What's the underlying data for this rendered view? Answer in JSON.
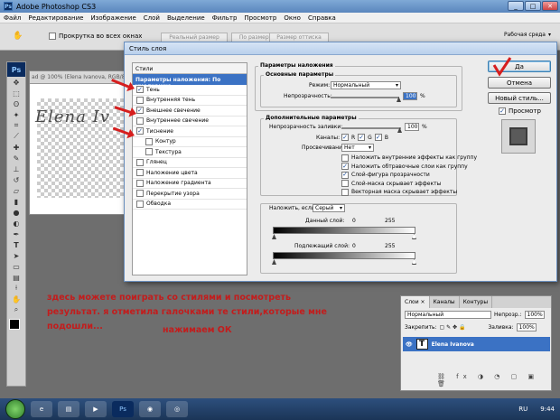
{
  "window": {
    "title": "Adobe Photoshop CS3",
    "app_icon": "Ps",
    "min_label": "_",
    "max_label": "□",
    "close_label": "✕"
  },
  "menu": [
    "Файл",
    "Редактирование",
    "Изображение",
    "Слой",
    "Выделение",
    "Фильтр",
    "Просмотр",
    "Окно",
    "Справка"
  ],
  "options": {
    "scroll_all": "Прокрутка во всех окнах",
    "actual_pixels": "Реальный размер",
    "fit_screen": "По размеру экрана",
    "print_size": "Размер оттиска",
    "workspace": "Рабочая среда"
  },
  "document": {
    "tab": "ad @ 100% (Elena Ivanova, RGB/8)",
    "signature": "Elena Iv"
  },
  "dialog": {
    "title": "Стиль слоя",
    "styles_header": "Стили",
    "blend_defaults": "Параметры наложения: По умолчанию",
    "styles": [
      {
        "label": "Тень",
        "checked": true
      },
      {
        "label": "Внутренняя тень",
        "checked": false
      },
      {
        "label": "Внешнее свечение",
        "checked": true
      },
      {
        "label": "Внутреннее свечение",
        "checked": false
      },
      {
        "label": "Тиснение",
        "checked": true
      },
      {
        "label": "Контур",
        "checked": false,
        "sub": true
      },
      {
        "label": "Текстура",
        "checked": false,
        "sub": true
      },
      {
        "label": "Глянец",
        "checked": false
      },
      {
        "label": "Наложение цвета",
        "checked": false
      },
      {
        "label": "Наложение градиента",
        "checked": false
      },
      {
        "label": "Перекрытие узора",
        "checked": false
      },
      {
        "label": "Обводка",
        "checked": false
      }
    ],
    "blend_options_title": "Параметры наложения",
    "basic_title": "Основные параметры",
    "mode_label": "Режим:",
    "mode_value": "Нормальный",
    "opacity_label": "Непрозрачность:",
    "opacity_value": "100",
    "percent": "%",
    "advanced_title": "Дополнительные параметры",
    "fill_opacity_label": "Непрозрачность заливки:",
    "fill_opacity_value": "100",
    "channels_label": "Каналы:",
    "channel_r": "R",
    "channel_g": "G",
    "channel_b": "B",
    "knockout_label": "Просвечивание:",
    "knockout_value": "Нет",
    "advanced_checks": [
      {
        "label": "Наложить внутренние эффекты как группу",
        "checked": false
      },
      {
        "label": "Наложить обтравочные слои как группу",
        "checked": true
      },
      {
        "label": "Слой-фигура прозрачности",
        "checked": true
      },
      {
        "label": "Слой-маска скрывает эффекты",
        "checked": false
      },
      {
        "label": "Векторная маска скрывает эффекты",
        "checked": false
      }
    ],
    "blend_if_label": "Наложить, если:",
    "blend_if_value": "Серый",
    "this_layer_label": "Данный слой:",
    "underlying_label": "Подлежащий слой:",
    "range_min": "0",
    "range_max": "255",
    "ok": "Да",
    "cancel": "Отмена",
    "new_style": "Новый стиль...",
    "preview": "Просмотр"
  },
  "note": {
    "line1": "здесь можете поиграть со стилями и посмотреть",
    "line2": "результат. я отметила галочками те стили,которые мне",
    "line3": "подошли...",
    "press": "нажимаем ОК"
  },
  "layers": {
    "tabs": [
      "Слои ×",
      "Каналы",
      "Контуры"
    ],
    "mode": "Нормальный",
    "opacity_label": "Непрозр.:",
    "opacity": "100%",
    "lock_label": "Закрепить:",
    "fill_label": "Заливка:",
    "fill": "100%",
    "layer_name": "Elena Ivanova",
    "layer_thumb": "T"
  },
  "taskbar": {
    "lang": "RU",
    "time": "9:44",
    "ps_label": "Ps"
  }
}
